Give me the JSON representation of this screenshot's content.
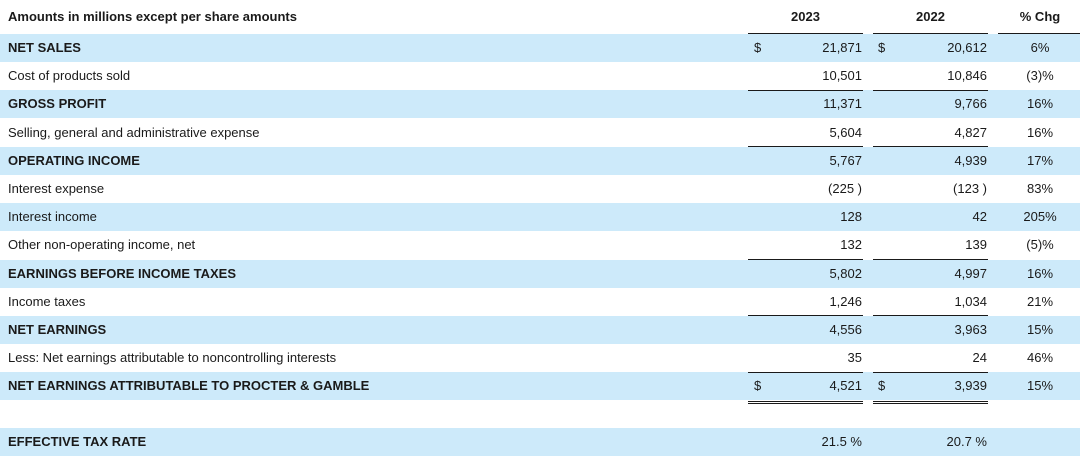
{
  "header": {
    "title": "Amounts in millions except per share amounts",
    "col_2023": "2023",
    "col_2022": "2022",
    "col_chg": "% Chg"
  },
  "rows": [
    {
      "label": "NET SALES",
      "bold": true,
      "shaded": true,
      "cur2023": "$",
      "v2023": "21,871",
      "cur2022": "$",
      "v2022": "20,612",
      "chg": "6%"
    },
    {
      "label": "Cost of products sold",
      "bold": false,
      "shaded": false,
      "cur2023": "",
      "v2023": "10,501",
      "cur2022": "",
      "v2022": "10,846",
      "chg": "(3)%"
    },
    {
      "label": "GROSS PROFIT",
      "bold": true,
      "shaded": true,
      "cur2023": "",
      "v2023": "11,371",
      "cur2022": "",
      "v2022": "9,766",
      "chg": "16%"
    },
    {
      "label": "Selling, general and administrative expense",
      "bold": false,
      "shaded": false,
      "cur2023": "",
      "v2023": "5,604",
      "cur2022": "",
      "v2022": "4,827",
      "chg": "16%"
    },
    {
      "label": "OPERATING INCOME",
      "bold": true,
      "shaded": true,
      "cur2023": "",
      "v2023": "5,767",
      "cur2022": "",
      "v2022": "4,939",
      "chg": "17%"
    },
    {
      "label": "Interest expense",
      "bold": false,
      "shaded": false,
      "cur2023": "",
      "v2023": "(225 )",
      "cur2022": "",
      "v2022": "(123 )",
      "chg": "83%"
    },
    {
      "label": "Interest income",
      "bold": false,
      "shaded": true,
      "cur2023": "",
      "v2023": "128",
      "cur2022": "",
      "v2022": "42",
      "chg": "205%"
    },
    {
      "label": "Other non-operating income, net",
      "bold": false,
      "shaded": false,
      "cur2023": "",
      "v2023": "132",
      "cur2022": "",
      "v2022": "139",
      "chg": "(5)%"
    },
    {
      "label": "EARNINGS BEFORE INCOME TAXES",
      "bold": true,
      "shaded": true,
      "cur2023": "",
      "v2023": "5,802",
      "cur2022": "",
      "v2022": "4,997",
      "chg": "16%"
    },
    {
      "label": "Income taxes",
      "bold": false,
      "shaded": false,
      "cur2023": "",
      "v2023": "1,246",
      "cur2022": "",
      "v2022": "1,034",
      "chg": "21%"
    },
    {
      "label": "NET EARNINGS",
      "bold": true,
      "shaded": true,
      "cur2023": "",
      "v2023": "4,556",
      "cur2022": "",
      "v2022": "3,963",
      "chg": "15%"
    },
    {
      "label": "Less: Net earnings attributable to noncontrolling interests",
      "bold": false,
      "shaded": false,
      "cur2023": "",
      "v2023": "35",
      "cur2022": "",
      "v2022": "24",
      "chg": "46%"
    },
    {
      "label": "NET EARNINGS ATTRIBUTABLE TO PROCTER & GAMBLE",
      "bold": true,
      "shaded": true,
      "cur2023": "$",
      "v2023": "4,521",
      "cur2022": "$",
      "v2022": "3,939",
      "chg": "15%"
    }
  ],
  "effective_tax_rate": {
    "label": "EFFECTIVE TAX RATE",
    "v2023": "21.5 %",
    "v2022": "20.7 %"
  },
  "colors": {
    "row_shade": "#cdeafa",
    "text": "#1a1a1a"
  }
}
